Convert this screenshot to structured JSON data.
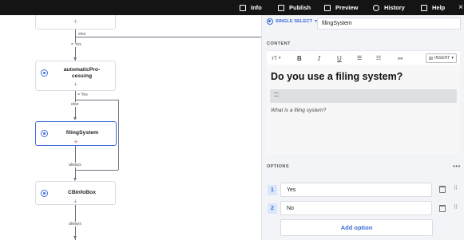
{
  "topbar": {
    "items": [
      {
        "label": "Info",
        "icon": "info-icon"
      },
      {
        "label": "Publish",
        "icon": "rocket-icon"
      },
      {
        "label": "Preview",
        "icon": "play-icon"
      },
      {
        "label": "History",
        "icon": "history-icon"
      },
      {
        "label": "Help",
        "icon": "help-icon"
      }
    ],
    "close_icon": "×"
  },
  "canvas": {
    "nodes": [
      {
        "title": "automaticPro-\ncessing",
        "plus": "+"
      },
      {
        "title": "filingSystem",
        "plus": "+"
      },
      {
        "title": "CBInfoBox",
        "plus": "+"
      }
    ],
    "connectors": {
      "else_1": "else",
      "yes_1": "= Yes",
      "yes_2": "= Yes",
      "else_2": "else",
      "always_1": "always",
      "always_2": "always"
    }
  },
  "panel": {
    "type_label": "SINGLE SELECT",
    "type_caret": "▾",
    "block_id": "filingSystem",
    "content_label": "CONTENT",
    "toolbar": {
      "text_style": "тT",
      "bold": "B",
      "italic": "I",
      "underline": "U",
      "insert_label": "INSERT"
    },
    "question": "Do you use a filing system?",
    "helper_text": "What is a filing system?",
    "options_label": "OPTIONS",
    "options_more": "•••",
    "options": [
      {
        "number": "1",
        "label": "Yes"
      },
      {
        "number": "2",
        "label": "No"
      }
    ],
    "add_option": "Add option"
  },
  "colors": {
    "accent": "#3d6bd7",
    "topbar_bg": "#141414",
    "panel_bg": "#f3f4f7"
  }
}
